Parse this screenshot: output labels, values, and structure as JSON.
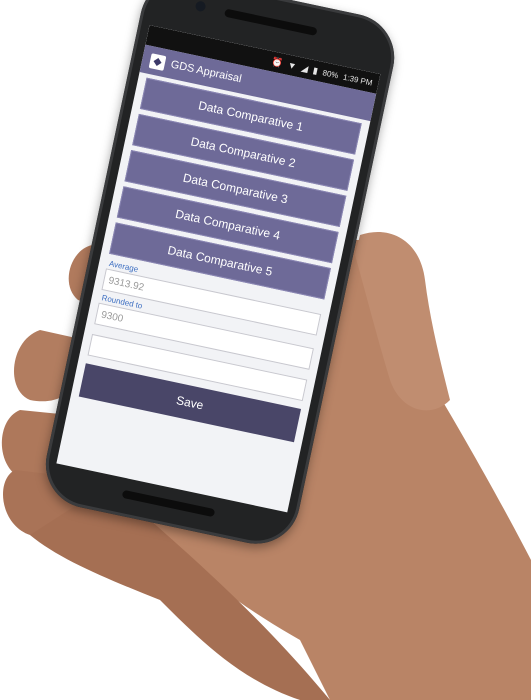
{
  "status_bar": {
    "battery": "80%",
    "time": "1:39 PM"
  },
  "app": {
    "title": "GDS Appraisal"
  },
  "comparatives": [
    {
      "label": "Data Comparative 1"
    },
    {
      "label": "Data Comparative 2"
    },
    {
      "label": "Data Comparative 3"
    },
    {
      "label": "Data Comparative 4"
    },
    {
      "label": "Data Comparative 5"
    }
  ],
  "average": {
    "label": "Average",
    "value": "9313.92"
  },
  "rounded": {
    "label": "Rounded to",
    "value": "9300"
  },
  "extra_field": {
    "value": ""
  },
  "save_label": "Save",
  "icons": [
    "alarm-icon",
    "wifi-icon",
    "signal-icon",
    "battery-icon",
    "app-logo-icon"
  ],
  "colors": {
    "accent": "#6e6a98",
    "save_button": "#494668",
    "label_blue": "#3d6fc2"
  }
}
